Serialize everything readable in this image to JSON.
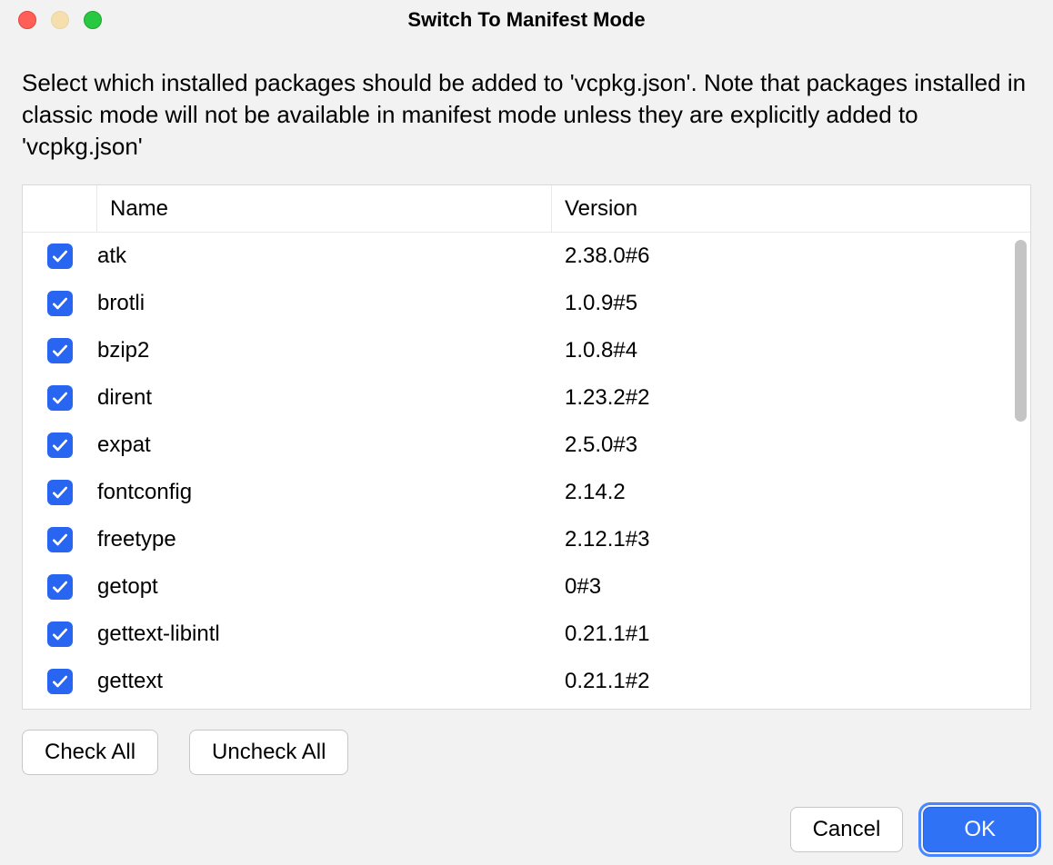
{
  "window": {
    "title": "Switch To Manifest Mode"
  },
  "description": "Select which installed packages should be added to 'vcpkg.json'. Note that packages installed in classic mode will not be available in manifest mode unless they are explicitly added to 'vcpkg.json'",
  "columns": {
    "name": "Name",
    "version": "Version"
  },
  "packages": [
    {
      "checked": true,
      "name": "atk",
      "version": "2.38.0#6"
    },
    {
      "checked": true,
      "name": "brotli",
      "version": "1.0.9#5"
    },
    {
      "checked": true,
      "name": "bzip2",
      "version": "1.0.8#4"
    },
    {
      "checked": true,
      "name": "dirent",
      "version": "1.23.2#2"
    },
    {
      "checked": true,
      "name": "expat",
      "version": "2.5.0#3"
    },
    {
      "checked": true,
      "name": "fontconfig",
      "version": "2.14.2"
    },
    {
      "checked": true,
      "name": "freetype",
      "version": "2.12.1#3"
    },
    {
      "checked": true,
      "name": "getopt",
      "version": "0#3"
    },
    {
      "checked": true,
      "name": "gettext-libintl",
      "version": "0.21.1#1"
    },
    {
      "checked": true,
      "name": "gettext",
      "version": "0.21.1#2"
    }
  ],
  "buttons": {
    "check_all": "Check All",
    "uncheck_all": "Uncheck All",
    "cancel": "Cancel",
    "ok": "OK"
  }
}
